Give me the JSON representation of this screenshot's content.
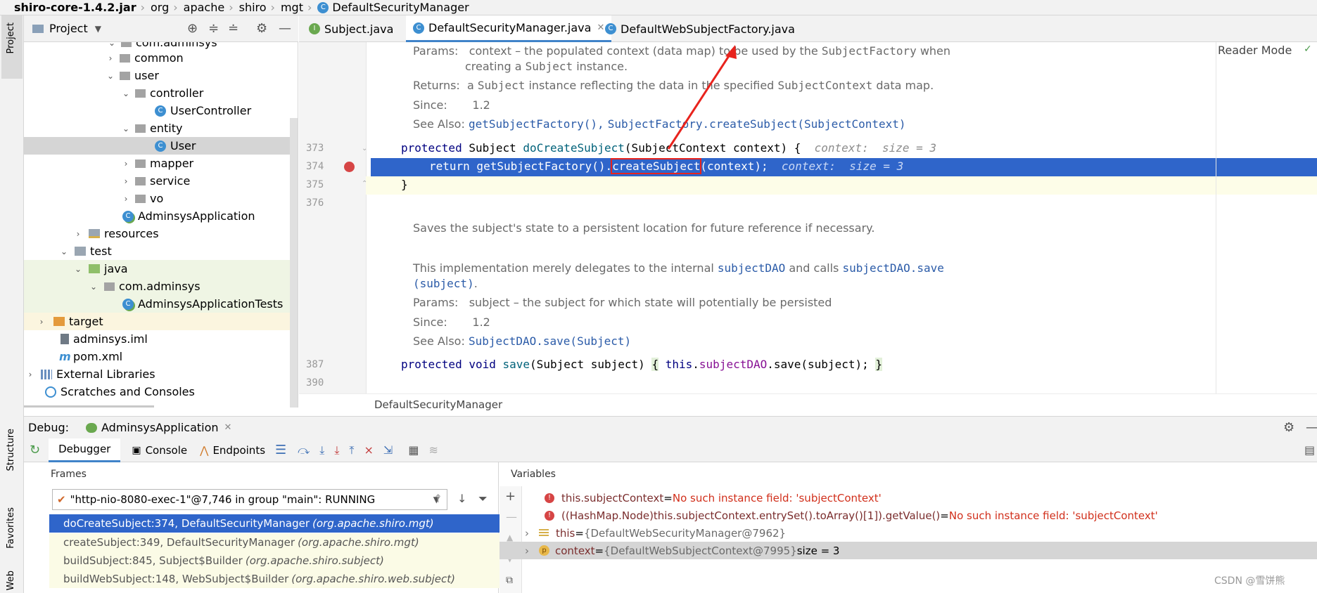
{
  "breadcrumb": {
    "jar": "shiro-core-1.4.2.jar",
    "parts": [
      "org",
      "apache",
      "shiro",
      "mgt"
    ],
    "current": "DefaultSecurityManager"
  },
  "left_strip": {
    "project": "Project",
    "structure": "Structure",
    "favorites": "Favorites",
    "web": "Web"
  },
  "project_panel": {
    "title": "Project",
    "items": [
      {
        "label": "com.adminsys",
        "kind": "package"
      },
      {
        "label": "common",
        "kind": "package"
      },
      {
        "label": "user",
        "kind": "package"
      },
      {
        "label": "controller",
        "kind": "package"
      },
      {
        "label": "UserController",
        "kind": "class"
      },
      {
        "label": "entity",
        "kind": "package"
      },
      {
        "label": "User",
        "kind": "class"
      },
      {
        "label": "mapper",
        "kind": "package"
      },
      {
        "label": "service",
        "kind": "package"
      },
      {
        "label": "vo",
        "kind": "package"
      },
      {
        "label": "AdminsysApplication",
        "kind": "app"
      },
      {
        "label": "resources",
        "kind": "folder"
      },
      {
        "label": "test",
        "kind": "folder"
      },
      {
        "label": "java",
        "kind": "folder"
      },
      {
        "label": "com.adminsys",
        "kind": "package"
      },
      {
        "label": "AdminsysApplicationTests",
        "kind": "app"
      },
      {
        "label": "target",
        "kind": "folder"
      },
      {
        "label": "adminsys.iml",
        "kind": "file"
      },
      {
        "label": "pom.xml",
        "kind": "file"
      },
      {
        "label": "External Libraries",
        "kind": "lib"
      },
      {
        "label": "Scratches and Consoles",
        "kind": "scratch"
      }
    ]
  },
  "tabs": [
    {
      "label": "Subject.java",
      "active": false
    },
    {
      "label": "DefaultSecurityManager.java",
      "active": true
    },
    {
      "label": "DefaultWebSubjectFactory.java",
      "active": false
    }
  ],
  "editor": {
    "reader_mode": "Reader Mode",
    "doc1": {
      "params_label": "Params:",
      "params_line1_a": "context – the populated context (data map) to be used by the",
      "params_line1_code": "SubjectFactory",
      "params_line1_b": "when",
      "params_line2_a": "creating a",
      "params_line2_code": "Subject",
      "params_line2_b": "instance.",
      "returns_label": "Returns:",
      "returns_a": "a",
      "returns_code1": "Subject",
      "returns_b": "instance reflecting the data in the specified",
      "returns_code2": "SubjectContext",
      "returns_c": "data map.",
      "since_label": "Since:",
      "since_value": "1.2",
      "seealso_label": "See Also:",
      "seealso_link1": "getSubjectFactory(),",
      "seealso_link2": "SubjectFactory.createSubject(SubjectContext)"
    },
    "lines": {
      "l373": "373",
      "l374": "374",
      "l375": "375",
      "l376": "376",
      "l387": "387",
      "l390": "390"
    },
    "code373": {
      "kw": "protected",
      "type": "Subject",
      "fn": "doCreateSubject",
      "rest": "(SubjectContext context) {",
      "hint": "context:  size = 3"
    },
    "code374": {
      "a": "return getSubjectFactory().",
      "boxed": "createSubject",
      "b": "(context);",
      "hint": "context:  size = 3"
    },
    "code375": "}",
    "doc2": {
      "summary": "Saves the subject's state to a persistent location for future reference if necessary.",
      "impl_a": "This implementation merely delegates to the internal",
      "impl_code1": "subjectDAO",
      "impl_b": "and calls",
      "impl_code2": "subjectDAO.save",
      "impl_code3": "(subject)",
      "impl_c": ".",
      "params_label": "Params:",
      "params_value": "subject – the subject for which state will potentially be persisted",
      "since_label": "Since:",
      "since_value": "1.2",
      "seealso_label": "See Also:",
      "seealso_link": "SubjectDAO.save(Subject)"
    },
    "code387": {
      "kw1": "protected",
      "kw2": "void",
      "fn": "save",
      "args": "(Subject subject)",
      "open": "{",
      "this": "this",
      "dot": ".",
      "field": "subjectDAO",
      "call": ".save(subject);",
      "close": "}"
    },
    "status_class": "DefaultSecurityManager"
  },
  "debug": {
    "label": "Debug:",
    "session": "AdminsysApplication",
    "tabs": {
      "debugger": "Debugger",
      "console": "Console",
      "endpoints": "Endpoints"
    },
    "frames_title": "Frames",
    "variables_title": "Variables",
    "thread": "\"http-nio-8080-exec-1\"@7,746 in group \"main\": RUNNING",
    "frames": [
      {
        "method": "doCreateSubject:374, DefaultSecurityManager",
        "pkg": "(org.apache.shiro.mgt)"
      },
      {
        "method": "createSubject:349, DefaultSecurityManager",
        "pkg": "(org.apache.shiro.mgt)"
      },
      {
        "method": "buildSubject:845, Subject$Builder",
        "pkg": "(org.apache.shiro.subject)"
      },
      {
        "method": "buildWebSubject:148, WebSubject$Builder",
        "pkg": "(org.apache.shiro.web.subject)"
      }
    ],
    "variables": [
      {
        "name": "this.subjectContext",
        "eq": " = ",
        "value": "No such instance field: 'subjectContext'",
        "extra": ""
      },
      {
        "name": "((HashMap.Node)this.subjectContext.entrySet().toArray()[1]).getValue()",
        "eq": " = ",
        "value": "No such instance field: 'subjectContext'",
        "extra": ""
      },
      {
        "name": "this",
        "eq": " = ",
        "value": "{DefaultWebSecurityManager@7962}",
        "extra": ""
      },
      {
        "name": "context",
        "eq": " = ",
        "value": "{DefaultWebSubjectContext@7995}",
        "extra": " size = 3"
      }
    ]
  },
  "watermark": "CSDN @雪饼熊",
  "colors": {
    "selection": "#2f65ca",
    "error": "#d12f1b",
    "annotation": "#e8231d"
  }
}
